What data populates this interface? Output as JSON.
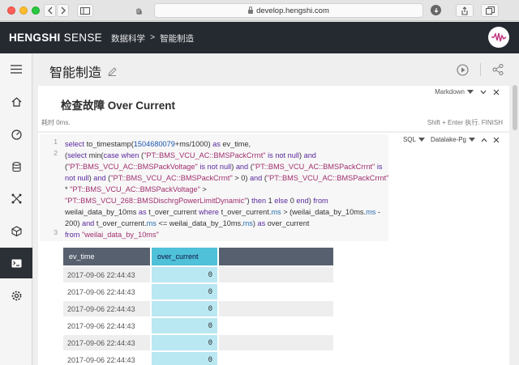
{
  "browser": {
    "url": "develop.hengshi.com"
  },
  "app": {
    "brand_bold": "HENGSHI",
    "brand_rest": "SENSE",
    "breadcrumb": [
      "数据科学",
      ">",
      "智能制造"
    ]
  },
  "page": {
    "title": "智能制造"
  },
  "markdown_cell": {
    "mode": "Markdown",
    "heading": "检查故障 Over Current",
    "elapsed": "耗时 0ms.",
    "hint": "Shift + Enter 执行. FINISH"
  },
  "sql_cell": {
    "language": "SQL",
    "connection": "Datalake-Pg",
    "line_numbers": [
      "1",
      "2",
      "3"
    ]
  },
  "result_table": {
    "columns": [
      "ev_time",
      "over_current",
      ""
    ],
    "rows": [
      [
        "2017-09-06 22:44:43",
        "0"
      ],
      [
        "2017-09-06 22:44:43",
        "0"
      ],
      [
        "2017-09-06 22:44:43",
        "0"
      ],
      [
        "2017-09-06 22:44:43",
        "0"
      ],
      [
        "2017-09-06 22:44:43",
        "0"
      ],
      [
        "2017-09-06 22:44:43",
        "0"
      ]
    ]
  },
  "colors": {
    "appbar": "#252a31",
    "header_dark": "#57606f",
    "header_accent": "#4fc1d9",
    "cell_accent": "#b9e7f2"
  }
}
